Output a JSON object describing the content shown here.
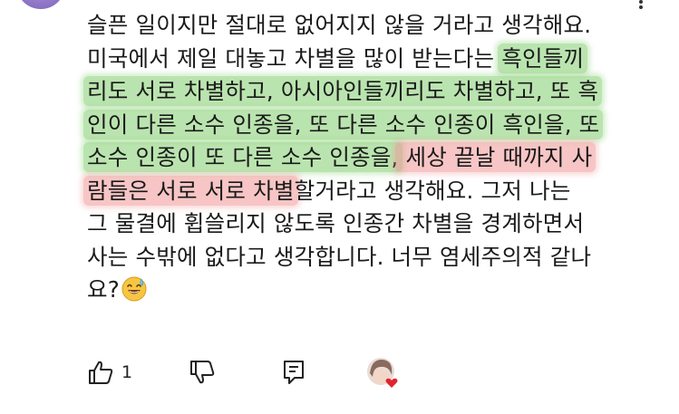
{
  "comment": {
    "lines": [
      [
        "슬픈 일이지만 절대로 없어지지 않을 거라고 생각해요."
      ],
      [
        "미국에서 제일 대놓고 차별을 많이 받는다는 ",
        "흑인들끼"
      ],
      [
        "리도 서로 차별하고, 아시아인들끼리도 차별하고, 또 흑"
      ],
      [
        "인이 다른 소수 인종을, 또 다른 소수 인종이 흑인을, 또"
      ],
      [
        "소수 인종이 또 다른 소수 인종을,",
        " 세상 끝날 때까지 사"
      ],
      [
        "람들은 서로 서로 차별",
        "할거라고 생각해요.  그저 나는"
      ],
      [
        "그 물결에 휩쓸리지 않도록 인종간 차별을 경계하면서"
      ],
      [
        "사는 수밖에 없다고 생각합니다.  너무 염세주의적 같나"
      ],
      [
        "요?"
      ]
    ]
  },
  "actions": {
    "like_count": "1",
    "like_icon": "thumbs-up-icon",
    "dislike_icon": "thumbs-down-icon",
    "reply_icon": "reply-comment-icon"
  },
  "colors": {
    "highlight_green": "#82cd6e",
    "highlight_red": "#f09696",
    "avatar_purple": "#8e74c6"
  }
}
